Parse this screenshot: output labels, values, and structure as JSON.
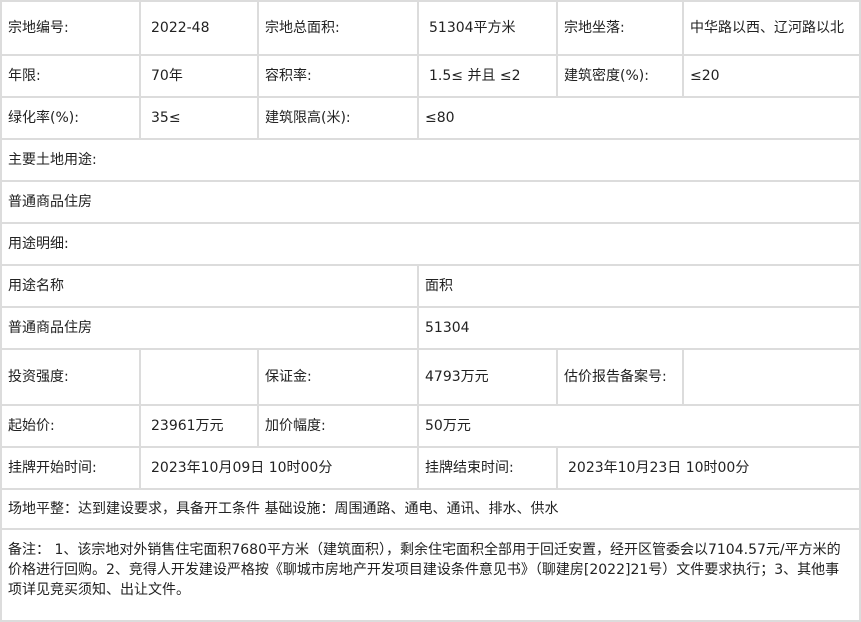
{
  "row1": {
    "code_label": "宗地编号:",
    "code": "2022-48",
    "area_label": "宗地总面积:",
    "area": "51304平方米",
    "location_label": "宗地坐落:",
    "location": " 中华路以西、辽河路以北"
  },
  "row2": {
    "term_label": "年限:",
    "term": "70年",
    "far_label": "容积率:",
    "far": "1.5≤ 并且 ≤2",
    "density_label": "建筑密度(%):",
    "density": "≤20"
  },
  "row3": {
    "green_label": "绿化率(%):",
    "green": "35≤",
    "height_label": "建筑限高(米):",
    "height": "≤80"
  },
  "row4": {
    "main_use_label": "主要土地用途:"
  },
  "row5": {
    "main_use": "普通商品住房"
  },
  "row6": {
    "detail_label": "用途明细:"
  },
  "row7": {
    "use_name_header": "用途名称",
    "use_area_header": "面积"
  },
  "row8": {
    "use_name": "普通商品住房",
    "use_area": "51304"
  },
  "row9": {
    "invest_label": "投资强度:",
    "invest": "",
    "deposit_label": "保证金:",
    "deposit": "4793万元",
    "appraisal_label": "估价报告备案号:",
    "appraisal": ""
  },
  "row10": {
    "start_price_label": "起始价:",
    "start_price": "23961万元",
    "increment_label": "加价幅度:",
    "increment": " 50万元"
  },
  "row11": {
    "start_time_label": "挂牌开始时间:",
    "start_time": "2023年10月09日 10时00分",
    "end_time_label": "挂牌结束时间:",
    "end_time": "2023年10月23日 10时00分"
  },
  "row12": {
    "site": "场地平整：达到建设要求，具备开工条件 基础设施：周围通路、通电、通讯、排水、供水"
  },
  "row13": {
    "remarks": "备注： 1、该宗地对外销售住宅面积7680平方米（建筑面积），剩余住宅面积全部用于回迁安置，经开区管委会以7104.57元/平方米的价格进行回购。2、竞得人开发建设严格按《聊城市房地产开发项目建设条件意见书》（聊建房[2022]21号）文件要求执行；3、其他事项详见竞买须知、出让文件。"
  }
}
